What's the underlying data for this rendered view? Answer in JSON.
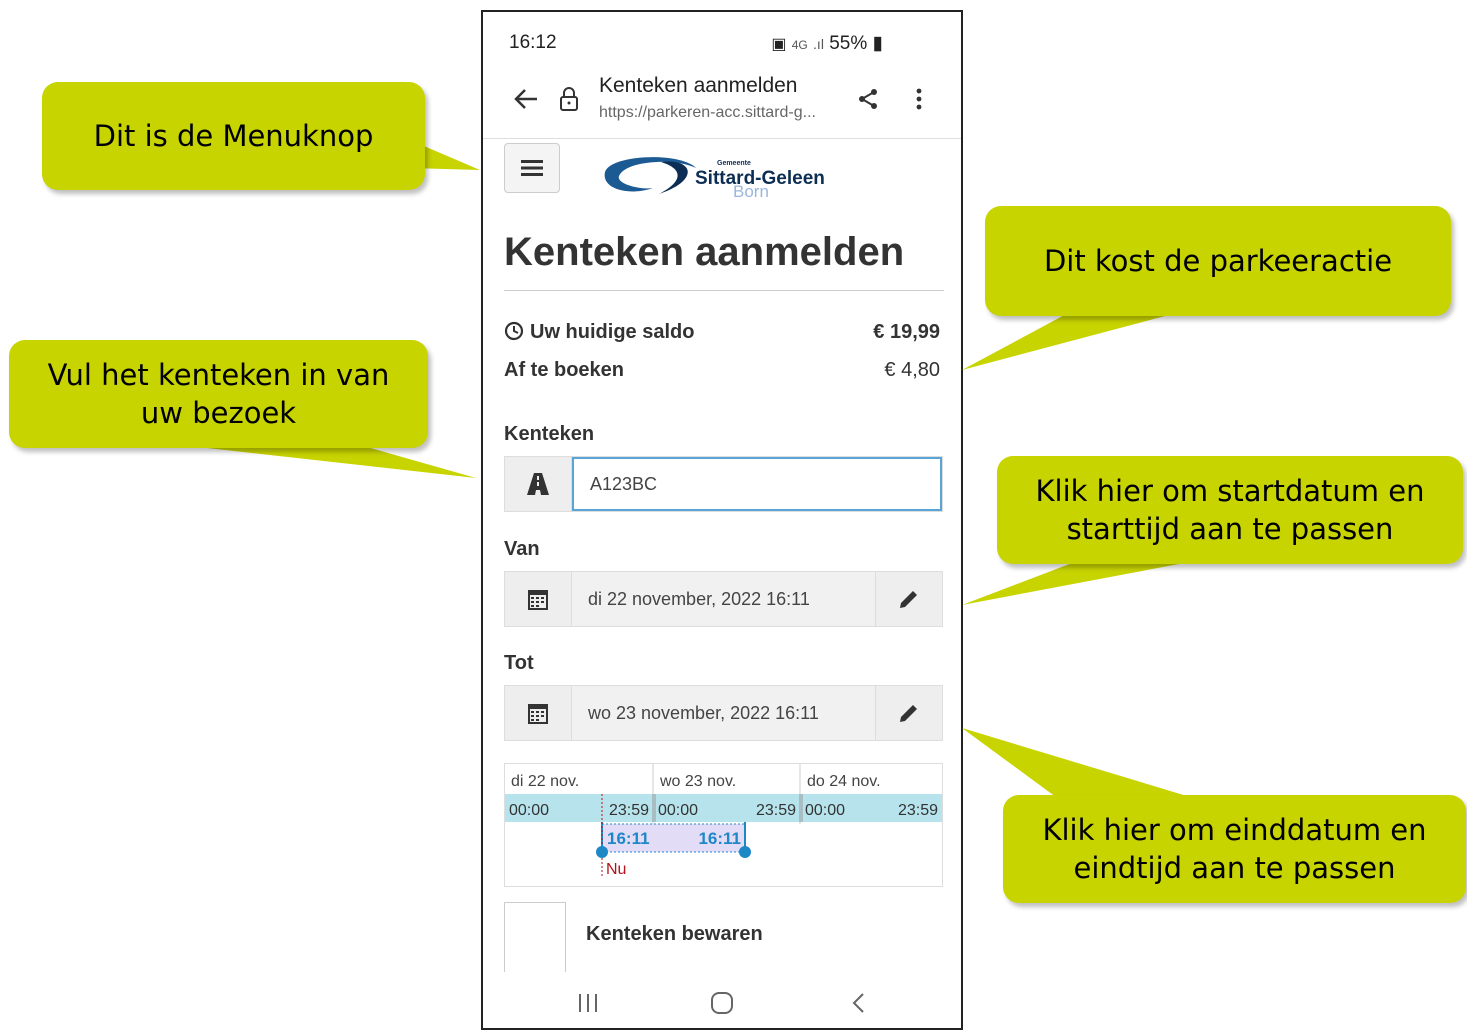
{
  "callouts": {
    "menu": "Dit is de Menuknop",
    "price": "Dit kost de parkeeractie",
    "plate": "Vul het kenteken in van uw bezoek",
    "start": "Klik hier om startdatum en starttijd aan te passen",
    "end": "Klik hier om einddatum en eindtijd aan te passen"
  },
  "status": {
    "time": "16:12",
    "battery": "55%"
  },
  "browser": {
    "title": "Kenteken aanmelden",
    "url": "https://parkeren-acc.sittard-g..."
  },
  "logo": {
    "small": "Gemeente",
    "name": "Sittard-Geleen",
    "sub": "Born"
  },
  "page": {
    "title": "Kenteken aanmelden",
    "saldo_label": "Uw huidige saldo",
    "saldo_value": "€ 19,99",
    "afboeken_label": "Af te boeken",
    "afboeken_value": "€ 4,80",
    "kenteken_label": "Kenteken",
    "kenteken_value": "A123BC",
    "van_label": "Van",
    "van_value": "di 22 november, 2022 16:11",
    "tot_label": "Tot",
    "tot_value": "wo 23 november, 2022 16:11",
    "bewaren_label": "Kenteken bewaren"
  },
  "timeline": {
    "days": [
      {
        "label": "di 22 nov.",
        "start": "00:00",
        "end": "23:59"
      },
      {
        "label": "wo 23 nov.",
        "start": "00:00",
        "end": "23:59"
      },
      {
        "label": "do 24 nov.",
        "start": "00:00",
        "end": "23:59"
      }
    ],
    "sel_start": "16:11",
    "sel_end": "16:11",
    "now_label": "Nu"
  },
  "colors": {
    "callout": "#c8d400",
    "accent": "#1e88c7",
    "now": "#b5121b"
  },
  "icons": [
    "back-arrow-icon",
    "lock-icon",
    "share-icon",
    "more-vert-icon",
    "hamburger-icon",
    "road-icon",
    "calendar-icon",
    "pencil-icon",
    "clock-icon"
  ]
}
